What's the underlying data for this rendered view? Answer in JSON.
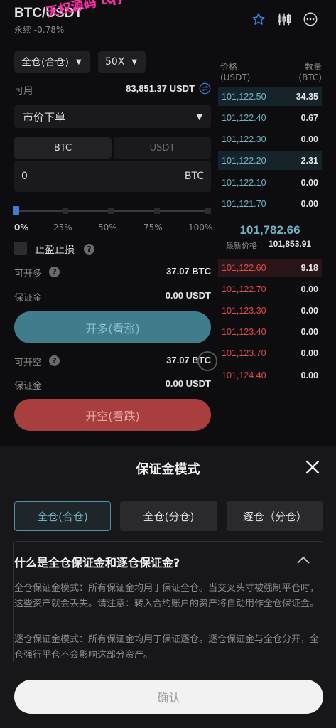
{
  "header": {
    "pair": "BTC/USDT",
    "perpetual": "永续",
    "change": "-0.78%",
    "watermark": "天权源码 tqym"
  },
  "margin_mode_select": {
    "value": "全仓(合仓)"
  },
  "leverage_select": {
    "value": "50X"
  },
  "available": {
    "label": "可用",
    "value": "83,851.37 USDT"
  },
  "order_type_select": {
    "value": "市价下单"
  },
  "unit_tabs": [
    "BTC",
    "USDT"
  ],
  "amount_input": {
    "value": "0",
    "unit": "BTC"
  },
  "slider": {
    "value": 0,
    "marks": [
      "0%",
      "25%",
      "50%",
      "75%",
      "100%"
    ]
  },
  "tp_sl": {
    "label": "止盈止损"
  },
  "long": {
    "can_open_label": "可开多",
    "can_open_value": "37.07 BTC",
    "margin_label": "保证金",
    "margin_value": "0.00 USDT",
    "button": "开多(看涨)"
  },
  "short": {
    "can_open_label": "可开空",
    "can_open_value": "37.07 BTC",
    "margin_label": "保证金",
    "margin_value": "0.00 USDT",
    "button": "开空(看跌)"
  },
  "orderbook": {
    "price_header": "价格",
    "price_unit": "(USDT)",
    "qty_header": "数量",
    "qty_unit": "(BTC)",
    "bids": [
      {
        "price": "101,122.50",
        "qty": "34.35"
      },
      {
        "price": "101,122.40",
        "qty": "0.67"
      },
      {
        "price": "101,122.30",
        "qty": "0.00"
      },
      {
        "price": "101,122.20",
        "qty": "2.31"
      },
      {
        "price": "101,122.10",
        "qty": "0.00"
      },
      {
        "price": "101,121.70",
        "qty": "0.00"
      }
    ],
    "mid_price": "101,782.66",
    "latest_label": "最新价格",
    "latest_price": "101,853.91",
    "asks": [
      {
        "price": "101,122.60",
        "qty": "9.18"
      },
      {
        "price": "101,122.70",
        "qty": "0.00"
      },
      {
        "price": "101,123.30",
        "qty": "0.00"
      },
      {
        "price": "101,123.40",
        "qty": "0.00"
      },
      {
        "price": "101,123.70",
        "qty": "0.00"
      },
      {
        "price": "101,124.40",
        "qty": "0.00"
      }
    ]
  },
  "modal": {
    "title": "保证金模式",
    "modes": [
      "全仓(合仓)",
      "全仓(分仓)",
      "逐仓（分仓）"
    ],
    "faq_title": "什么是全仓保证金和逐仓保证金?",
    "faq_p1": "全仓保证金模式：所有保证金均用于保证全仓。当交叉头寸被强制平仓时，这些资产就会丢失。请注意：转入合约账户的资产将自动用作全仓保证金。",
    "faq_p2": "逐仓保证金模式：所有保证金均用于保证逐仓。逐仓保证金与全仓分开，全仓强行平仓不会影响这部分资产。",
    "confirm": "确认"
  },
  "colors": {
    "bid": "#6fb3c8",
    "ask": "#e04b4b",
    "long_button": "#3f7d8c",
    "short_button": "#a83e3e",
    "accent": "#3b7dd8"
  }
}
